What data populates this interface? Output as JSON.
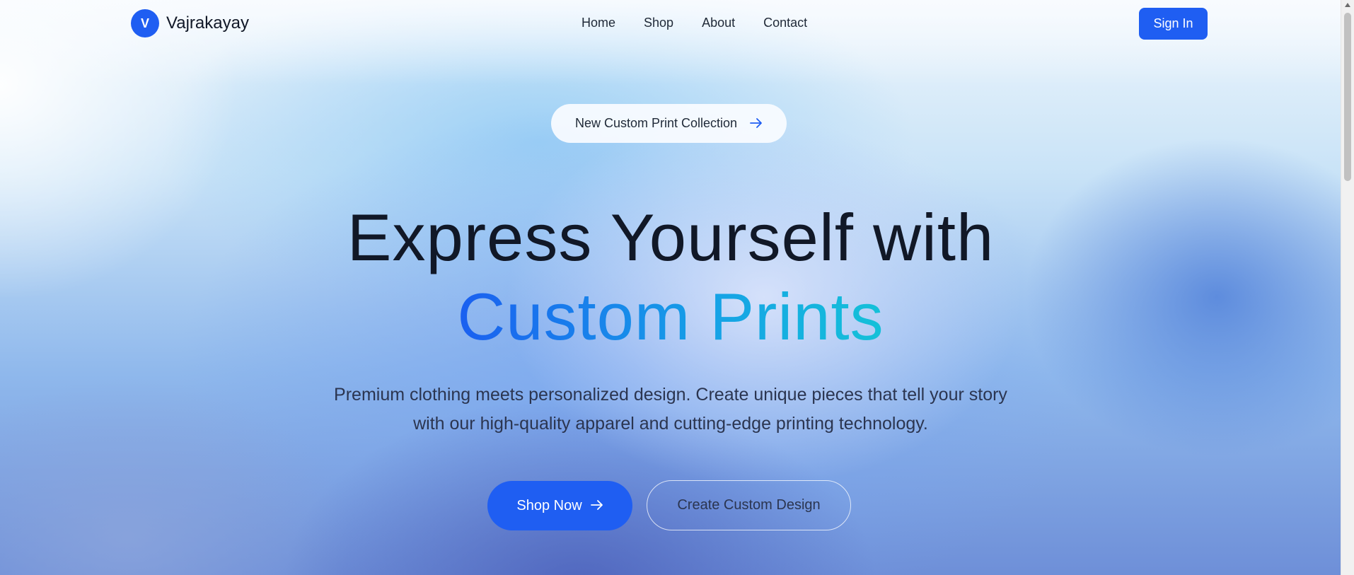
{
  "header": {
    "brand_initial": "V",
    "brand_name": "Vajrakayay",
    "nav": [
      "Home",
      "Shop",
      "About",
      "Contact"
    ],
    "signin_label": "Sign In"
  },
  "hero": {
    "badge_label": "New Custom Print Collection",
    "badge_icon": "arrow-right-icon",
    "headline_line1": "Express Yourself with",
    "headline_line2": "Custom Prints",
    "description": "Premium clothing meets personalized design. Create unique pieces that tell your story with our high-quality apparel and cutting-edge printing technology.",
    "primary_cta": "Shop Now",
    "secondary_cta": "Create Custom Design"
  },
  "colors": {
    "accent": "#1f5ef2",
    "gradient_start": "#1a5ff0",
    "gradient_end": "#14c1d8",
    "text_dark": "#111827"
  }
}
